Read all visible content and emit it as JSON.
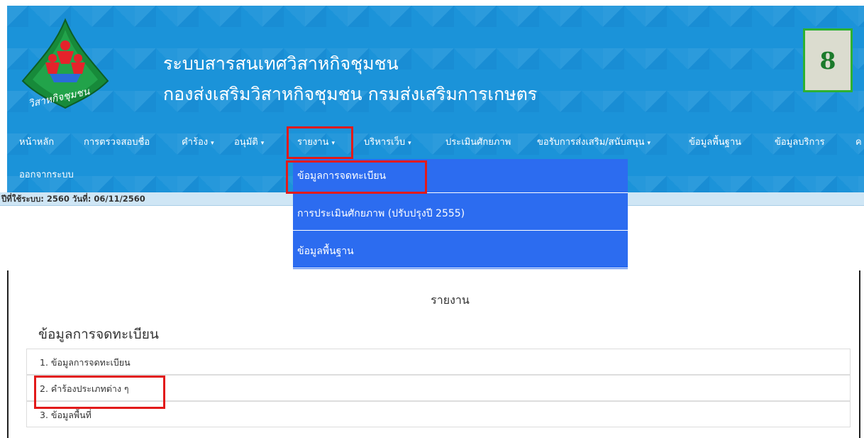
{
  "header": {
    "title_line1": "ระบบสารสนเทศวิสาหกิจชุมชน",
    "title_line2": "กองส่งเสริมวิสาหกิจชุมชน  กรมส่งเสริมการเกษตร",
    "logo_text": "วิสาหกิจชุมชน",
    "page_number": "8"
  },
  "nav": {
    "items": [
      {
        "label": "หน้าหลัก",
        "caret": ""
      },
      {
        "label": "การตรวจสอบชื่อ",
        "caret": ""
      },
      {
        "label": "คำร้อง",
        "caret": "▾"
      },
      {
        "label": "อนุมัติ",
        "caret": "▾"
      },
      {
        "label": "รายงาน",
        "caret": "▾"
      },
      {
        "label": "บริหารเว็บ",
        "caret": "▾"
      },
      {
        "label": "ประเมินศักยภาพ",
        "caret": ""
      },
      {
        "label": "ขอรับการส่งเสริม/สนับสนุน",
        "caret": "▾"
      },
      {
        "label": "ข้อมูลพื้นฐาน",
        "caret": ""
      },
      {
        "label": "ข้อมูลบริการ",
        "caret": ""
      },
      {
        "label": "ค",
        "caret": ""
      }
    ],
    "logout_label": "ออกจากระบบ"
  },
  "status": {
    "text": "ปีที่ใช้ระบบ: 2560 วันที่: 06/11/2560"
  },
  "dropdown": {
    "items": [
      "ข้อมูลการจดทะเบียน",
      "การประเมินศักยภาพ (ปรับปรุงปี 2555)",
      "ข้อมูลพื้นฐาน"
    ]
  },
  "content": {
    "heading": "รายงาน",
    "section_title": "ข้อมูลการจดทะเบียน",
    "items": [
      "1. ข้อมูลการจดทะเบียน",
      "2. คำร้องประเภทต่าง ๆ",
      "3. ข้อมูลพื้นที่"
    ]
  },
  "colors": {
    "header_bg": "#1b93d9",
    "dropdown_bg": "#2c6cf0",
    "annotation_red": "#e21a1a",
    "badge_border": "#2db132"
  }
}
